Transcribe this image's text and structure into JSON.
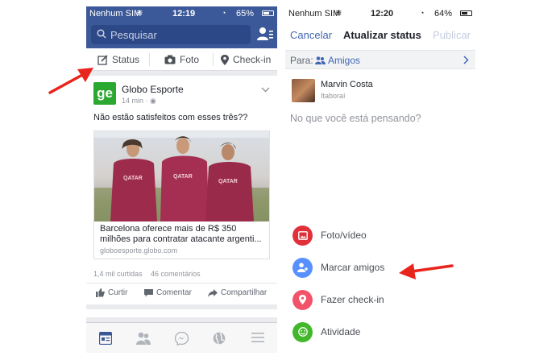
{
  "left": {
    "status_bar": {
      "carrier": "Nenhum SIM",
      "time": "12:19",
      "battery": "65%"
    },
    "search": {
      "placeholder": "Pesquisar"
    },
    "composer": {
      "status": "Status",
      "photo": "Foto",
      "checkin": "Check-in"
    },
    "post": {
      "author": "Globo Esporte",
      "logo_text": "ge",
      "time": "14 min · ",
      "message": "Não estão satisfeitos com esses três??",
      "link_title_line1": "Barcelona oferece mais de R$ 350",
      "link_title_line2": "milhões para contratar atacante argenti...",
      "link_domain": "globoesporte.globo.com",
      "likes": "1,4 mil curtidas",
      "comments": "46 comentários",
      "actions": {
        "like": "Curtir",
        "comment": "Comentar",
        "share": "Compartilhar"
      },
      "jersey_text": "QATAR"
    },
    "tabs": [
      "news-feed",
      "friends",
      "messenger",
      "globe",
      "menu"
    ]
  },
  "right": {
    "status_bar": {
      "carrier": "Nenhum SIM",
      "time": "12:20",
      "battery": "64%"
    },
    "nav": {
      "cancel": "Cancelar",
      "title": "Atualizar status",
      "publish": "Publicar"
    },
    "audience": {
      "label": "Para:",
      "value": "Amigos"
    },
    "user": {
      "name": "Marvin Costa",
      "location": "Itaboraí"
    },
    "composer_placeholder": "No que você está pensando?",
    "options": [
      {
        "label": "Foto/vídeo",
        "color": "#e0313b",
        "icon": "photo-icon"
      },
      {
        "label": "Marcar amigos",
        "color": "#5890ff",
        "icon": "tag-friends-icon"
      },
      {
        "label": "Fazer check-in",
        "color": "#f35369",
        "icon": "location-icon"
      },
      {
        "label": "Atividade",
        "color": "#42b72a",
        "icon": "smiley-icon"
      }
    ]
  },
  "colors": {
    "facebook_blue": "#3b5998",
    "annotation_red": "#e8251c"
  }
}
